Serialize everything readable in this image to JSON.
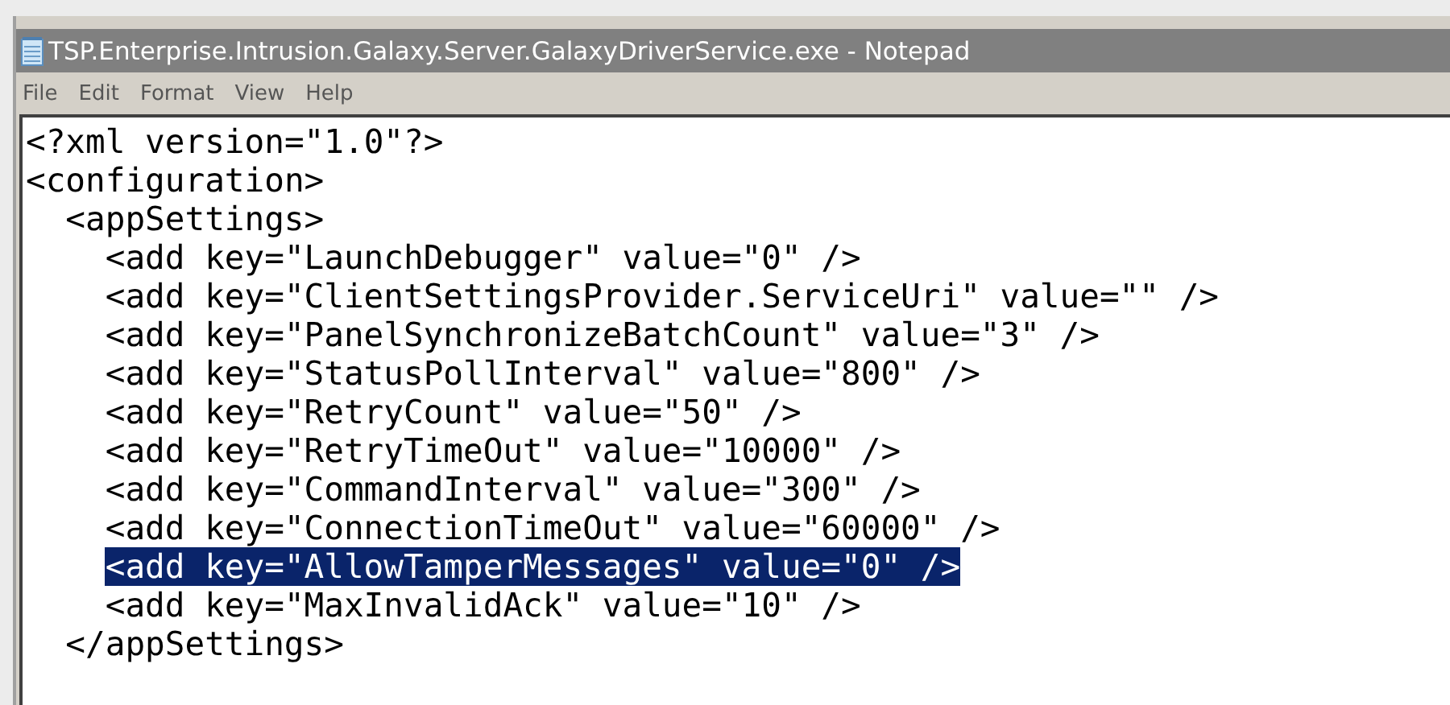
{
  "window": {
    "title": "TSP.Enterprise.Intrusion.Galaxy.Server.GalaxyDriverService.exe - Notepad"
  },
  "menu": [
    "File",
    "Edit",
    "Format",
    "View",
    "Help"
  ],
  "lines": [
    {
      "text": "<?xml version=\"1.0\"?>",
      "selected": false
    },
    {
      "text": "<configuration>",
      "selected": false,
      "children": [
        {
          "text": "<appSettings>",
          "selected": false,
          "children": [
            {
              "text": "<add key=\"LaunchDebugger\" value=\"0\" />",
              "selected": false
            },
            {
              "text": "<add key=\"ClientSettingsProvider.ServiceUri\" value=\"\" />",
              "selected": false
            },
            {
              "text": "<add key=\"PanelSynchronizeBatchCount\" value=\"3\" />",
              "selected": false
            },
            {
              "text": "<add key=\"StatusPollInterval\" value=\"800\" />",
              "selected": false
            },
            {
              "text": "<add key=\"RetryCount\" value=\"50\" />",
              "selected": false
            },
            {
              "text": "<add key=\"RetryTimeOut\" value=\"10000\" />",
              "selected": false
            },
            {
              "text": "<add key=\"CommandInterval\" value=\"300\" />",
              "selected": false
            },
            {
              "text": "<add key=\"ConnectionTimeOut\" value=\"60000\" />",
              "selected": false
            },
            {
              "text": "<add key=\"AllowTamperMessages\" value=\"0\" />",
              "selected": true
            },
            {
              "text": "<add key=\"MaxInvalidAck\" value=\"10\" />",
              "selected": false
            }
          ]
        },
        {
          "text": "</appSettings>",
          "selected": false
        }
      ]
    }
  ]
}
